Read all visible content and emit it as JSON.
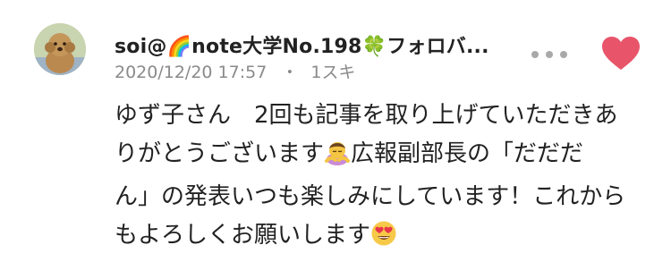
{
  "comment": {
    "user_name": "soi@🌈note大学No.198🍀フォロバ...",
    "timestamp": "2020/12/20 17:57",
    "separator": "・",
    "likes_label": "1スキ",
    "body_lines": [
      "ゆず子さん　2回も記事を取り上げていただきあ",
      "りがとうございます",
      "広報副部長の「だだだ",
      "ん」の発表いつも楽しみにしています！これから",
      "もよろしくお願いします"
    ],
    "icons": {
      "more": "more-dots-icon",
      "like": "heart-icon",
      "emoji_1": "bowing-woman-emoji",
      "emoji_2": "heart-eyes-emoji"
    },
    "colors": {
      "like": "#e8556b",
      "meta_text": "#8a8a8a",
      "text": "#222222"
    }
  }
}
